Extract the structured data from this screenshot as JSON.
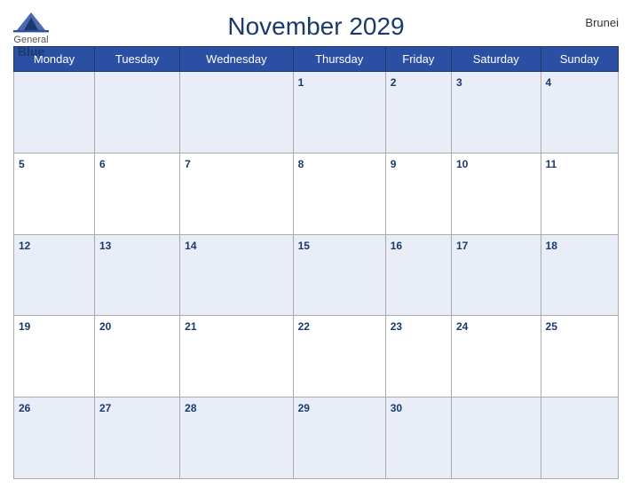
{
  "header": {
    "logo": {
      "general": "General",
      "blue": "Blue"
    },
    "title": "November 2029",
    "country": "Brunei"
  },
  "calendar": {
    "weekdays": [
      "Monday",
      "Tuesday",
      "Wednesday",
      "Thursday",
      "Friday",
      "Saturday",
      "Sunday"
    ],
    "rows": [
      [
        {
          "day": "",
          "empty": true
        },
        {
          "day": "",
          "empty": true
        },
        {
          "day": "",
          "empty": true
        },
        {
          "day": "1"
        },
        {
          "day": "2"
        },
        {
          "day": "3"
        },
        {
          "day": "4"
        }
      ],
      [
        {
          "day": "5"
        },
        {
          "day": "6"
        },
        {
          "day": "7"
        },
        {
          "day": "8"
        },
        {
          "day": "9"
        },
        {
          "day": "10"
        },
        {
          "day": "11"
        }
      ],
      [
        {
          "day": "12"
        },
        {
          "day": "13"
        },
        {
          "day": "14"
        },
        {
          "day": "15"
        },
        {
          "day": "16"
        },
        {
          "day": "17"
        },
        {
          "day": "18"
        }
      ],
      [
        {
          "day": "19"
        },
        {
          "day": "20"
        },
        {
          "day": "21"
        },
        {
          "day": "22"
        },
        {
          "day": "23"
        },
        {
          "day": "24"
        },
        {
          "day": "25"
        }
      ],
      [
        {
          "day": "26"
        },
        {
          "day": "27"
        },
        {
          "day": "28"
        },
        {
          "day": "29"
        },
        {
          "day": "30"
        },
        {
          "day": "",
          "empty": true
        },
        {
          "day": "",
          "empty": true
        }
      ]
    ]
  }
}
